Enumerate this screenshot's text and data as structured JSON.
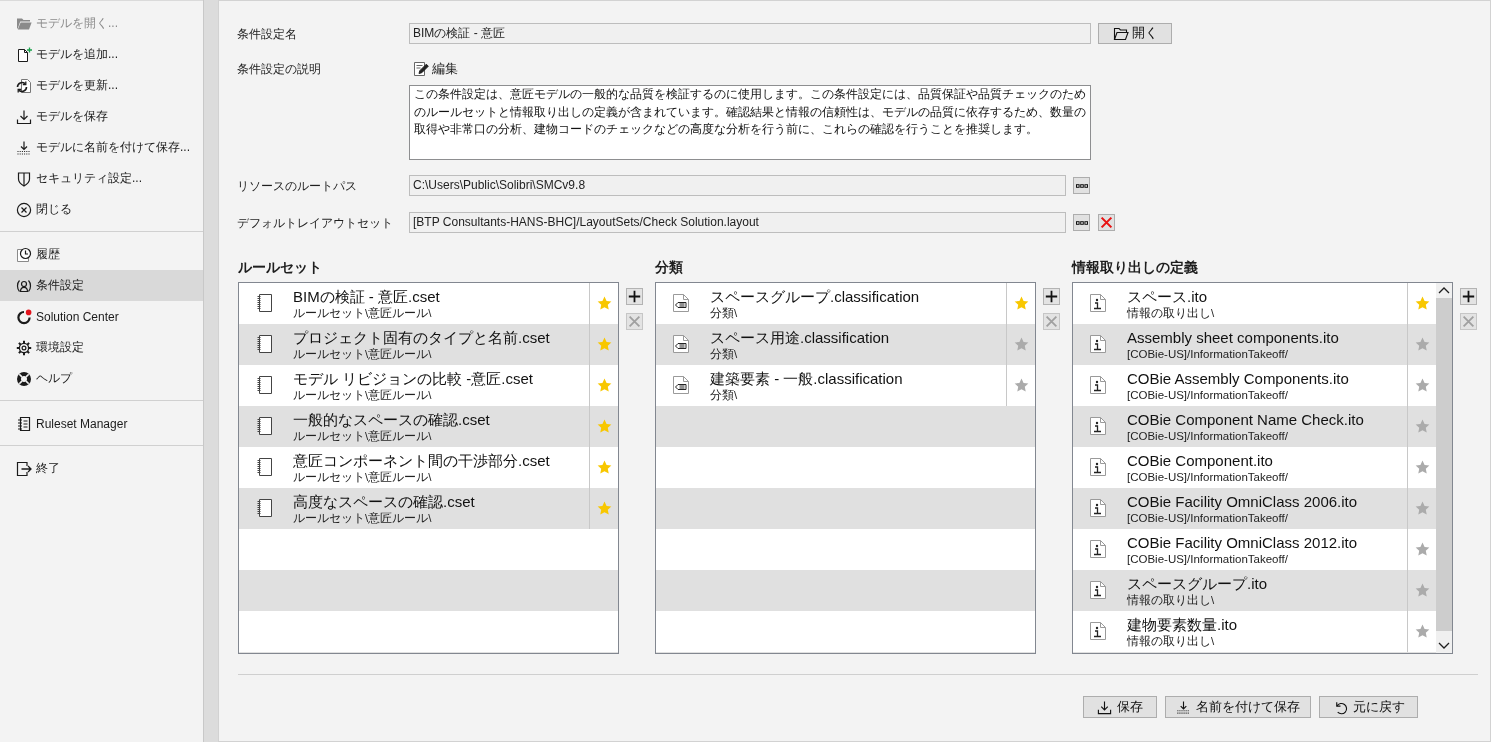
{
  "sidebar": {
    "groups": [
      {
        "items": [
          {
            "label": "モデルを開く...",
            "disabled": true,
            "selected": false
          },
          {
            "label": "モデルを追加...",
            "disabled": false,
            "selected": false
          },
          {
            "label": "モデルを更新...",
            "disabled": false,
            "selected": false
          },
          {
            "label": "モデルを保存",
            "disabled": false,
            "selected": false
          },
          {
            "label": "モデルに名前を付けて保存...",
            "disabled": false,
            "selected": false
          },
          {
            "label": "セキュリティ設定...",
            "disabled": false,
            "selected": false
          },
          {
            "label": "閉じる",
            "disabled": false,
            "selected": false
          }
        ]
      },
      {
        "items": [
          {
            "label": "履歴",
            "disabled": false,
            "selected": false
          },
          {
            "label": "条件設定",
            "disabled": false,
            "selected": true
          },
          {
            "label": "Solution Center",
            "disabled": false,
            "selected": false
          },
          {
            "label": "環境設定",
            "disabled": false,
            "selected": false
          },
          {
            "label": "ヘルプ",
            "disabled": false,
            "selected": false
          }
        ]
      },
      {
        "items": [
          {
            "label": "Ruleset Manager",
            "disabled": false,
            "selected": false
          }
        ]
      },
      {
        "items": [
          {
            "label": "終了",
            "disabled": false,
            "selected": false
          }
        ]
      }
    ]
  },
  "form": [
    {
      "kind": "name",
      "label": "条件設定名",
      "value": "BIMの検証 - 意匠",
      "button": "開く"
    },
    {
      "kind": "description",
      "label": "条件設定の説明",
      "button": "編集",
      "value": "この条件設定は、意匠モデルの一般的な品質を検証するのに使用します。この条件設定には、品質保証や品質チェックのためのルールセットと情報取り出しの定義が含まれています。確認結果と情報の信頼性は、モデルの品質に依存するため、数量の取得や非常口の分析、建物コードのチェックなどの高度な分析を行う前に、これらの確認を行うことを推奨します。"
    },
    {
      "kind": "path",
      "label": "リソースのルートパス",
      "value": "C:\\Users\\Public\\Solibri\\SMCv9.8",
      "clearable": false
    },
    {
      "kind": "path",
      "label": "デフォルトレイアウトセット",
      "value": "[BTP Consultants-HANS-BHC]/LayoutSets/Check Solution.layout",
      "clearable": true
    }
  ],
  "lists": [
    {
      "kind": "ruleset",
      "title": "ルールセット",
      "scrollbar": false,
      "items": [
        {
          "name": "BIMの検証 - 意匠.cset",
          "path": "ルールセット\\意匠ルール\\",
          "favorite": true
        },
        {
          "name": "プロジェクト固有のタイプと名前.cset",
          "path": "ルールセット\\意匠ルール\\",
          "favorite": true
        },
        {
          "name": "モデル リビジョンの比較 -意匠.cset",
          "path": "ルールセット\\意匠ルール\\",
          "favorite": true
        },
        {
          "name": "一般的なスペースの確認.cset",
          "path": "ルールセット\\意匠ルール\\",
          "favorite": true
        },
        {
          "name": "意匠コンポーネント間の干渉部分.cset",
          "path": "ルールセット\\意匠ルール\\",
          "favorite": true
        },
        {
          "name": "高度なスペースの確認.cset",
          "path": "ルールセット\\意匠ルール\\",
          "favorite": true
        }
      ],
      "buttons": [
        {
          "kind": "add",
          "disabled": false
        },
        {
          "kind": "remove",
          "disabled": true
        }
      ]
    },
    {
      "kind": "classification",
      "title": "分類",
      "scrollbar": false,
      "items": [
        {
          "name": "スペースグループ.classification",
          "path": "分類\\",
          "favorite": true
        },
        {
          "name": "スペース用途.classification",
          "path": "分類\\",
          "favorite": false
        },
        {
          "name": "建築要素 - 一般.classification",
          "path": "分類\\",
          "favorite": false
        }
      ],
      "buttons": [
        {
          "kind": "add",
          "disabled": false
        },
        {
          "kind": "remove",
          "disabled": true
        }
      ]
    },
    {
      "kind": "takeoff",
      "title": "情報取り出しの定義",
      "scrollbar": true,
      "items": [
        {
          "name": "スペース.ito",
          "path": "情報の取り出し\\",
          "favorite": true
        },
        {
          "name": "Assembly sheet components.ito",
          "path": "[COBie-US]/InformationTakeoff/",
          "favorite": false
        },
        {
          "name": "COBie Assembly Components.ito",
          "path": "[COBie-US]/InformationTakeoff/",
          "favorite": false
        },
        {
          "name": "COBie Component Name Check.ito",
          "path": "[COBie-US]/InformationTakeoff/",
          "favorite": false
        },
        {
          "name": "COBie Component.ito",
          "path": "[COBie-US]/InformationTakeoff/",
          "favorite": false
        },
        {
          "name": "COBie Facility OmniClass 2006.ito",
          "path": "[COBie-US]/InformationTakeoff/",
          "favorite": false
        },
        {
          "name": "COBie Facility OmniClass 2012.ito",
          "path": "[COBie-US]/InformationTakeoff/",
          "favorite": false
        },
        {
          "name": "スペースグループ.ito",
          "path": "情報の取り出し\\",
          "favorite": false
        },
        {
          "name": "建物要素数量.ito",
          "path": "情報の取り出し\\",
          "favorite": false
        }
      ],
      "buttons": [
        {
          "kind": "add",
          "disabled": false
        },
        {
          "kind": "remove",
          "disabled": true
        }
      ]
    }
  ],
  "footer": {
    "buttons": [
      {
        "kind": "save",
        "label": "保存"
      },
      {
        "kind": "save_as",
        "label": "名前を付けて保存"
      },
      {
        "kind": "revert",
        "label": "元に戻す"
      }
    ]
  }
}
